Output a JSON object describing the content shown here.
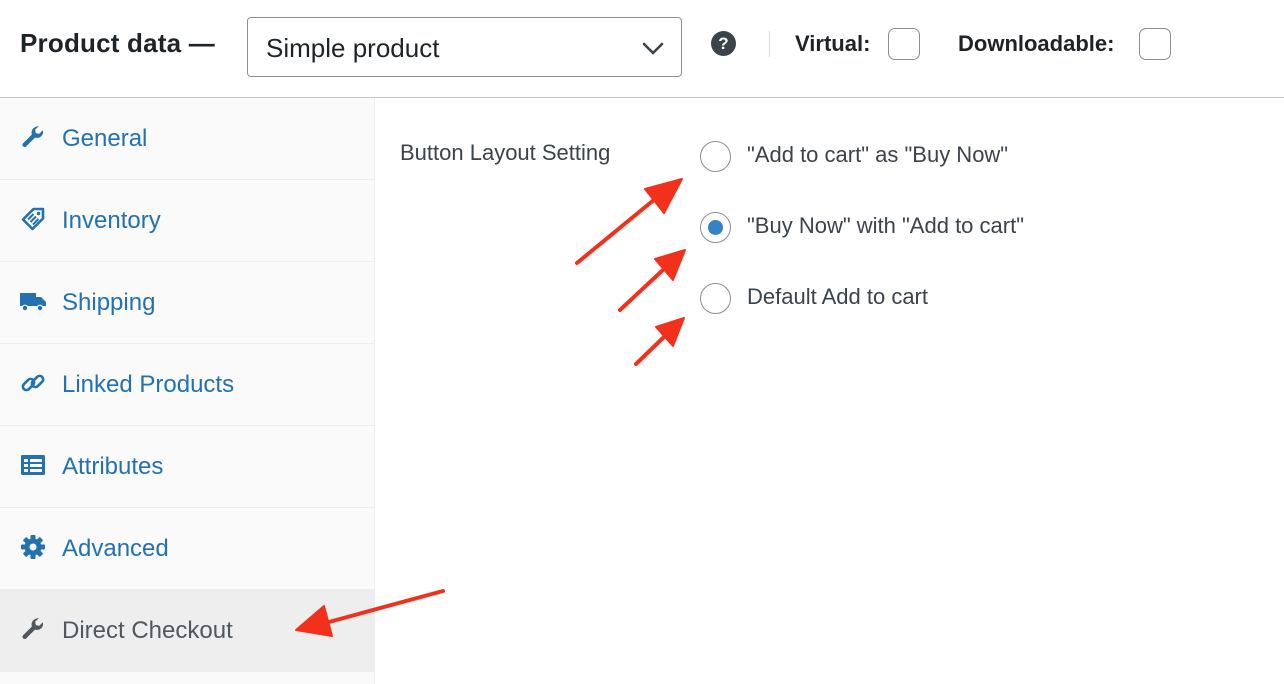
{
  "header": {
    "title": "Product data —",
    "product_type": {
      "selected": "Simple product"
    },
    "help_icon": "question-icon",
    "virtual_label": "Virtual:",
    "downloadable_label": "Downloadable:"
  },
  "sidebar": {
    "items": [
      {
        "label": "General",
        "icon": "wrench-icon"
      },
      {
        "label": "Inventory",
        "icon": "tag-icon"
      },
      {
        "label": "Shipping",
        "icon": "truck-icon"
      },
      {
        "label": "Linked Products",
        "icon": "link-icon"
      },
      {
        "label": "Attributes",
        "icon": "list-icon"
      },
      {
        "label": "Advanced",
        "icon": "gear-icon"
      },
      {
        "label": "Direct Checkout",
        "icon": "wrench-icon"
      }
    ]
  },
  "main": {
    "field_label": "Button Layout Setting",
    "options": [
      {
        "label": "\"Add to cart\" as \"Buy Now\"",
        "checked": false
      },
      {
        "label": "\"Buy Now\" with \"Add to cart\"",
        "checked": true
      },
      {
        "label": "Default Add to cart",
        "checked": false
      }
    ]
  },
  "colors": {
    "link_blue": "#2271b1",
    "radio_blue": "#3582c4",
    "annotation_red": "#f2311c"
  }
}
